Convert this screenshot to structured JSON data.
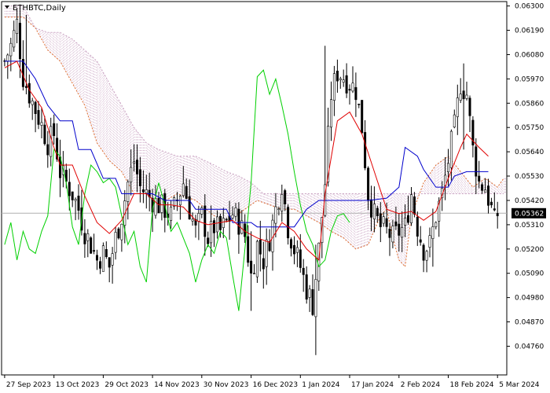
{
  "symbol_label": "ETHBTC,Daily",
  "colors": {
    "background": "#ffffff",
    "candle": "#000000",
    "tenkan": "#e00000",
    "kijun": "#0000cc",
    "chikou": "#00d000",
    "span_a": "#e07030",
    "span_b": "#c8a0c0",
    "price_line": "#b0b0b0",
    "price_tag_bg": "#000000"
  },
  "chart_data": {
    "type": "candlestick",
    "indicator": "Ichimoku Kinko Hyo",
    "current_price": 0.05362,
    "current_price_label": "0.05362",
    "ylim": [
      0.0463,
      0.0632
    ],
    "y_ticks": [
      0.063,
      0.0619,
      0.0608,
      0.0597,
      0.0586,
      0.0575,
      0.0564,
      0.0553,
      0.0542,
      0.0531,
      0.052,
      0.0509,
      0.0498,
      0.0487,
      0.0476
    ],
    "y_tick_labels": [
      "0.06300",
      "0.06190",
      "0.06080",
      "0.05970",
      "0.05860",
      "0.05750",
      "0.05640",
      "0.05530",
      "0.05420",
      "0.05310",
      "0.05200",
      "0.05090",
      "0.04980",
      "0.04870",
      "0.04760"
    ],
    "x_tick_labels": [
      "27 Sep 2023",
      "13 Oct 2023",
      "29 Oct 2023",
      "14 Nov 2023",
      "30 Nov 2023",
      "16 Dec 2023",
      "1 Jan 2024",
      "17 Jan 2024",
      "2 Feb 2024",
      "18 Feb 2024",
      "5 Mar 2024"
    ],
    "x_tick_days": [
      0,
      16,
      32,
      48,
      64,
      80,
      96,
      112,
      128,
      144,
      160
    ],
    "close_path": [
      [
        0,
        0.0605
      ],
      [
        2,
        0.0612
      ],
      [
        4,
        0.0622
      ],
      [
        6,
        0.0598
      ],
      [
        8,
        0.059
      ],
      [
        10,
        0.0583
      ],
      [
        12,
        0.0576
      ],
      [
        14,
        0.0568
      ],
      [
        16,
        0.0572
      ],
      [
        18,
        0.0555
      ],
      [
        20,
        0.055
      ],
      [
        22,
        0.0545
      ],
      [
        24,
        0.0538
      ],
      [
        26,
        0.0528
      ],
      [
        28,
        0.0522
      ],
      [
        30,
        0.0515
      ],
      [
        32,
        0.0518
      ],
      [
        34,
        0.0512
      ],
      [
        36,
        0.0525
      ],
      [
        38,
        0.0535
      ],
      [
        40,
        0.055
      ],
      [
        42,
        0.056
      ],
      [
        44,
        0.0548
      ],
      [
        46,
        0.0545
      ],
      [
        48,
        0.0542
      ],
      [
        50,
        0.054
      ],
      [
        52,
        0.0538
      ],
      [
        54,
        0.0535
      ],
      [
        56,
        0.0542
      ],
      [
        58,
        0.055
      ],
      [
        60,
        0.0538
      ],
      [
        62,
        0.0528
      ],
      [
        64,
        0.0535
      ],
      [
        66,
        0.0525
      ],
      [
        68,
        0.053
      ],
      [
        70,
        0.0528
      ],
      [
        72,
        0.0532
      ],
      [
        74,
        0.0536
      ],
      [
        76,
        0.0532
      ],
      [
        78,
        0.0526
      ],
      [
        80,
        0.0508
      ],
      [
        82,
        0.0522
      ],
      [
        84,
        0.0515
      ],
      [
        86,
        0.0525
      ],
      [
        88,
        0.0538
      ],
      [
        90,
        0.055
      ],
      [
        92,
        0.053
      ],
      [
        94,
        0.052
      ],
      [
        96,
        0.0512
      ],
      [
        98,
        0.0502
      ],
      [
        100,
        0.0495
      ],
      [
        102,
        0.052
      ],
      [
        104,
        0.055
      ],
      [
        106,
        0.059
      ],
      [
        108,
        0.06
      ],
      [
        110,
        0.0598
      ],
      [
        112,
        0.0595
      ],
      [
        114,
        0.0592
      ],
      [
        116,
        0.0575
      ],
      [
        118,
        0.0545
      ],
      [
        120,
        0.0535
      ],
      [
        122,
        0.053
      ],
      [
        124,
        0.0528
      ],
      [
        126,
        0.0525
      ],
      [
        128,
        0.0528
      ],
      [
        130,
        0.053
      ],
      [
        132,
        0.0545
      ],
      [
        134,
        0.053
      ],
      [
        136,
        0.052
      ],
      [
        138,
        0.0522
      ],
      [
        140,
        0.0535
      ],
      [
        142,
        0.0545
      ],
      [
        144,
        0.056
      ],
      [
        146,
        0.0575
      ],
      [
        148,
        0.0595
      ],
      [
        150,
        0.059
      ],
      [
        152,
        0.0565
      ],
      [
        154,
        0.055
      ],
      [
        156,
        0.0548
      ],
      [
        158,
        0.0538
      ],
      [
        159,
        0.0532
      ],
      [
        160,
        0.0536
      ]
    ],
    "tenkan": [
      [
        0,
        0.0602
      ],
      [
        4,
        0.0605
      ],
      [
        8,
        0.0592
      ],
      [
        12,
        0.0584
      ],
      [
        16,
        0.0566
      ],
      [
        18,
        0.0558
      ],
      [
        22,
        0.0558
      ],
      [
        26,
        0.0544
      ],
      [
        30,
        0.0532
      ],
      [
        34,
        0.0527
      ],
      [
        38,
        0.0533
      ],
      [
        42,
        0.0545
      ],
      [
        46,
        0.0545
      ],
      [
        50,
        0.054
      ],
      [
        54,
        0.054
      ],
      [
        58,
        0.0539
      ],
      [
        62,
        0.0533
      ],
      [
        66,
        0.0531
      ],
      [
        70,
        0.0532
      ],
      [
        74,
        0.0533
      ],
      [
        78,
        0.0528
      ],
      [
        82,
        0.0525
      ],
      [
        86,
        0.0523
      ],
      [
        90,
        0.0532
      ],
      [
        94,
        0.0528
      ],
      [
        98,
        0.052
      ],
      [
        102,
        0.0515
      ],
      [
        104,
        0.0545
      ],
      [
        108,
        0.0578
      ],
      [
        112,
        0.0582
      ],
      [
        116,
        0.0572
      ],
      [
        120,
        0.0555
      ],
      [
        124,
        0.0538
      ],
      [
        128,
        0.0536
      ],
      [
        132,
        0.0537
      ],
      [
        136,
        0.0533
      ],
      [
        140,
        0.0537
      ],
      [
        144,
        0.0552
      ],
      [
        148,
        0.0566
      ],
      [
        150,
        0.0572
      ],
      [
        154,
        0.0566
      ],
      [
        157,
        0.0562
      ]
    ],
    "kijun": [
      [
        0,
        0.0605
      ],
      [
        6,
        0.0605
      ],
      [
        10,
        0.0597
      ],
      [
        14,
        0.0585
      ],
      [
        18,
        0.0578
      ],
      [
        22,
        0.0578
      ],
      [
        24,
        0.0565
      ],
      [
        28,
        0.0565
      ],
      [
        32,
        0.0552
      ],
      [
        36,
        0.0552
      ],
      [
        38,
        0.0545
      ],
      [
        48,
        0.0545
      ],
      [
        52,
        0.0542
      ],
      [
        60,
        0.0542
      ],
      [
        62,
        0.0538
      ],
      [
        72,
        0.0538
      ],
      [
        74,
        0.0532
      ],
      [
        80,
        0.0532
      ],
      [
        82,
        0.053
      ],
      [
        94,
        0.053
      ],
      [
        98,
        0.0538
      ],
      [
        102,
        0.0542
      ],
      [
        114,
        0.0542
      ],
      [
        118,
        0.0542
      ],
      [
        124,
        0.0543
      ],
      [
        128,
        0.0548
      ],
      [
        130,
        0.0566
      ],
      [
        134,
        0.0562
      ],
      [
        136,
        0.0556
      ],
      [
        140,
        0.0548
      ],
      [
        144,
        0.0548
      ],
      [
        146,
        0.0553
      ],
      [
        150,
        0.0555
      ],
      [
        157,
        0.0555
      ]
    ],
    "chikou": [
      [
        0,
        0.0522
      ],
      [
        2,
        0.0532
      ],
      [
        4,
        0.0515
      ],
      [
        6,
        0.0528
      ],
      [
        8,
        0.052
      ],
      [
        10,
        0.0518
      ],
      [
        12,
        0.0528
      ],
      [
        14,
        0.0535
      ],
      [
        16,
        0.0565
      ],
      [
        18,
        0.0562
      ],
      [
        20,
        0.055
      ],
      [
        22,
        0.053
      ],
      [
        24,
        0.0522
      ],
      [
        26,
        0.0545
      ],
      [
        28,
        0.0558
      ],
      [
        30,
        0.0555
      ],
      [
        32,
        0.055
      ],
      [
        34,
        0.0552
      ],
      [
        36,
        0.0548
      ],
      [
        38,
        0.0535
      ],
      [
        40,
        0.0522
      ],
      [
        42,
        0.0528
      ],
      [
        44,
        0.0512
      ],
      [
        46,
        0.0505
      ],
      [
        48,
        0.0538
      ],
      [
        50,
        0.055
      ],
      [
        52,
        0.054
      ],
      [
        54,
        0.0528
      ],
      [
        56,
        0.0532
      ],
      [
        58,
        0.0525
      ],
      [
        60,
        0.0518
      ],
      [
        62,
        0.0505
      ],
      [
        64,
        0.0515
      ],
      [
        66,
        0.0522
      ],
      [
        68,
        0.0518
      ],
      [
        70,
        0.0528
      ],
      [
        72,
        0.0525
      ],
      [
        74,
        0.0508
      ],
      [
        76,
        0.0492
      ],
      [
        78,
        0.052
      ],
      [
        80,
        0.055
      ],
      [
        82,
        0.0598
      ],
      [
        84,
        0.0601
      ],
      [
        86,
        0.059
      ],
      [
        88,
        0.0597
      ],
      [
        90,
        0.0585
      ],
      [
        92,
        0.0572
      ],
      [
        94,
        0.0555
      ],
      [
        96,
        0.054
      ],
      [
        98,
        0.0528
      ],
      [
        100,
        0.0522
      ],
      [
        102,
        0.0512
      ],
      [
        104,
        0.0515
      ],
      [
        106,
        0.0528
      ],
      [
        108,
        0.0535
      ],
      [
        110,
        0.0536
      ],
      [
        112,
        0.0532
      ]
    ],
    "span_a": [
      [
        0,
        0.0625
      ],
      [
        6,
        0.0625
      ],
      [
        10,
        0.062
      ],
      [
        14,
        0.061
      ],
      [
        18,
        0.0605
      ],
      [
        22,
        0.0595
      ],
      [
        26,
        0.0585
      ],
      [
        30,
        0.0568
      ],
      [
        34,
        0.056
      ],
      [
        38,
        0.0555
      ],
      [
        42,
        0.0545
      ],
      [
        46,
        0.0545
      ],
      [
        50,
        0.054
      ],
      [
        56,
        0.0545
      ],
      [
        62,
        0.0542
      ],
      [
        68,
        0.0535
      ],
      [
        72,
        0.0532
      ],
      [
        78,
        0.0538
      ],
      [
        82,
        0.0542
      ],
      [
        86,
        0.054
      ],
      [
        90,
        0.0538
      ],
      [
        94,
        0.0538
      ],
      [
        98,
        0.0535
      ],
      [
        102,
        0.0532
      ],
      [
        106,
        0.0528
      ],
      [
        110,
        0.0525
      ],
      [
        114,
        0.052
      ],
      [
        118,
        0.0522
      ],
      [
        122,
        0.0535
      ],
      [
        124,
        0.0538
      ],
      [
        126,
        0.0525
      ],
      [
        128,
        0.0515
      ],
      [
        130,
        0.0512
      ],
      [
        132,
        0.0535
      ],
      [
        136,
        0.055
      ],
      [
        140,
        0.0558
      ],
      [
        144,
        0.0562
      ],
      [
        148,
        0.0555
      ],
      [
        152,
        0.0548
      ],
      [
        156,
        0.0552
      ],
      [
        160,
        0.0548
      ],
      [
        162,
        0.0552
      ]
    ],
    "span_b": [
      [
        0,
        0.063
      ],
      [
        6,
        0.063
      ],
      [
        10,
        0.062
      ],
      [
        14,
        0.0618
      ],
      [
        18,
        0.0618
      ],
      [
        22,
        0.0615
      ],
      [
        26,
        0.061
      ],
      [
        30,
        0.0605
      ],
      [
        34,
        0.0595
      ],
      [
        38,
        0.0585
      ],
      [
        42,
        0.0575
      ],
      [
        46,
        0.0568
      ],
      [
        50,
        0.0565
      ],
      [
        56,
        0.0562
      ],
      [
        62,
        0.0562
      ],
      [
        68,
        0.0558
      ],
      [
        72,
        0.0555
      ],
      [
        76,
        0.0553
      ],
      [
        80,
        0.055
      ],
      [
        84,
        0.0545
      ],
      [
        88,
        0.0545
      ],
      [
        92,
        0.0545
      ],
      [
        96,
        0.0545
      ],
      [
        100,
        0.0545
      ],
      [
        104,
        0.0545
      ],
      [
        108,
        0.0545
      ],
      [
        112,
        0.0545
      ],
      [
        116,
        0.0545
      ],
      [
        120,
        0.0545
      ],
      [
        124,
        0.0545
      ],
      [
        128,
        0.0545
      ],
      [
        132,
        0.0545
      ],
      [
        136,
        0.0545
      ],
      [
        140,
        0.0545
      ],
      [
        144,
        0.0545
      ],
      [
        148,
        0.0545
      ],
      [
        152,
        0.0545
      ],
      [
        156,
        0.0545
      ],
      [
        160,
        0.0545
      ],
      [
        162,
        0.0545
      ]
    ],
    "extremes": [
      {
        "day": 101,
        "high": 0.0522,
        "low": 0.0472
      },
      {
        "day": 104,
        "high": 0.0612,
        "low": 0.0535
      },
      {
        "day": 149,
        "high": 0.0604,
        "low": 0.0565
      },
      {
        "day": 139,
        "high": 0.0532,
        "low": 0.0512
      },
      {
        "day": 80,
        "high": 0.0528,
        "low": 0.0492
      },
      {
        "day": 7,
        "high": 0.0626,
        "low": 0.059
      }
    ]
  }
}
